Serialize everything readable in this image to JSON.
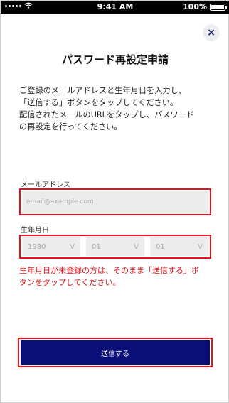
{
  "status_bar": {
    "time": "9:41 AM",
    "battery": "100%",
    "battery_level": 1.0,
    "wifi_icon": "wifi-icon"
  },
  "header": {
    "close_label": "×",
    "title": "パスワード再設定申請"
  },
  "description": {
    "line1": "ご登録のメールアドレスと生年月日を入力し、",
    "line2": "「送信する」ボタンをタップしてください。",
    "line3": "配信されたメールのURLをタップし、パスワード",
    "line4": "の再設定を行ってください。"
  },
  "form": {
    "email_label": "メールアドレス",
    "email_placeholder": "email@axample.com",
    "email_value": "",
    "birth_label": "生年月日",
    "year": "1980",
    "month": "01",
    "day": "01"
  },
  "warning": {
    "line1": "生年月日が未登録の方は、そのまま「送信する」ボ",
    "line2": "タンをタップしてください。"
  },
  "submit": {
    "label": "送信する"
  },
  "colors": {
    "accent": "#0a0f7a",
    "highlight": "#e8101a",
    "warning_text": "#e8101a"
  }
}
